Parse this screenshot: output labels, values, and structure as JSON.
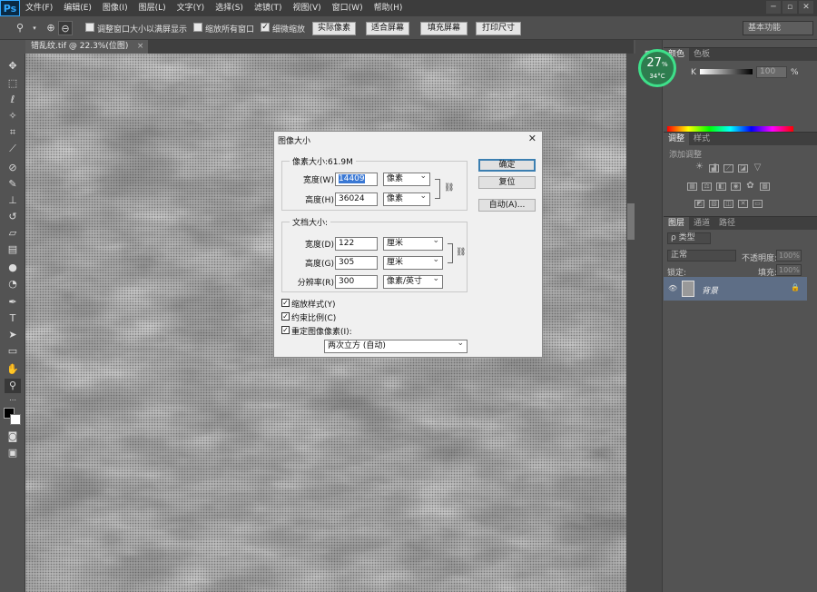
{
  "app": {
    "logo": "Ps"
  },
  "menu": [
    "文件(F)",
    "编辑(E)",
    "图像(I)",
    "图层(L)",
    "文字(Y)",
    "选择(S)",
    "滤镜(T)",
    "视图(V)",
    "窗口(W)",
    "帮助(H)"
  ],
  "window_controls": {
    "minimize": "─",
    "restore": "▫",
    "close": "✕"
  },
  "options_bar": {
    "resize_windows_label": "调整窗口大小以满屏显示",
    "zoom_all_label": "缩放所有窗口",
    "scrubby_zoom_label": "细微缩放",
    "actual_pixels": "实际像素",
    "fit_screen": "适合屏幕",
    "fill_screen": "填充屏幕",
    "print_size": "打印尺寸",
    "workspace": "基本功能"
  },
  "document": {
    "tab_title": "错乱纹.tif @ 22.3%(位图)",
    "close_label": "×"
  },
  "gauge": {
    "percent": "27",
    "percent_sign": "%",
    "temp": "34°C",
    "level": 0.27
  },
  "color_panel": {
    "tabs": [
      "颜色",
      "色板"
    ],
    "channel": "K",
    "value": "100",
    "unit": "%"
  },
  "adjust_panel": {
    "tabs": [
      "调整",
      "样式"
    ],
    "title": "添加调整"
  },
  "layers_panel": {
    "tabs": [
      "图层",
      "通道",
      "路径"
    ],
    "filter_label": "ρ 类型",
    "blend_mode": "正常",
    "opacity_label": "不透明度:",
    "opacity_value": "100%",
    "lock_label": "锁定:",
    "fill_label": "填充:",
    "fill_value": "100%",
    "layer_name": "背景"
  },
  "dialog": {
    "title": "图像大小",
    "close": "✕",
    "pixel_dim_title": "像素大小:61.9M",
    "width_label": "宽度(W):",
    "width_value": "14409",
    "width_unit": "像素",
    "height_label": "高度(H):",
    "height_value": "36024",
    "height_unit": "像素",
    "doc_size_title": "文档大小:",
    "doc_width_label": "宽度(D):",
    "doc_width_value": "122",
    "doc_width_unit": "厘米",
    "doc_height_label": "高度(G):",
    "doc_height_value": "305",
    "doc_height_unit": "厘米",
    "resolution_label": "分辨率(R):",
    "resolution_value": "300",
    "resolution_unit": "像素/英寸",
    "scale_styles": "缩放样式(Y)",
    "constrain": "约束比例(C)",
    "resample": "重定图像像素(I):",
    "resample_method": "两次立方 (自动)",
    "ok": "确定",
    "reset": "复位",
    "auto": "自动(A)..."
  }
}
